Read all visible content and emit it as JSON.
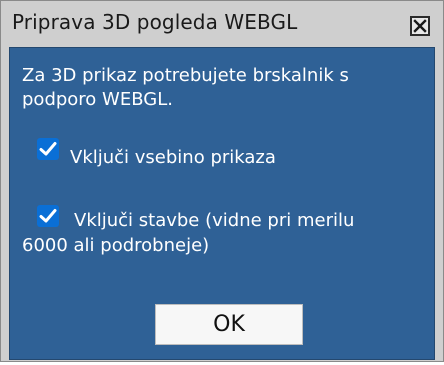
{
  "dialog": {
    "title": "Priprava 3D pogleda WEBGL",
    "close_icon": "close-icon",
    "message": "Za 3D prikaz potrebujete brskalnik s podporo WEBGL.",
    "options": [
      {
        "label": "Vključi vsebino prikaza",
        "checked": true
      },
      {
        "label_line1": "Vključi stavbe (vidne pri merilu",
        "label_line2": "6000 ali podrobneje)",
        "checked": true
      }
    ],
    "ok_label": "OK",
    "colors": {
      "panel": "#2f6196",
      "checkbox": "#0a6fd6",
      "frame": "#cfcfcf"
    }
  }
}
